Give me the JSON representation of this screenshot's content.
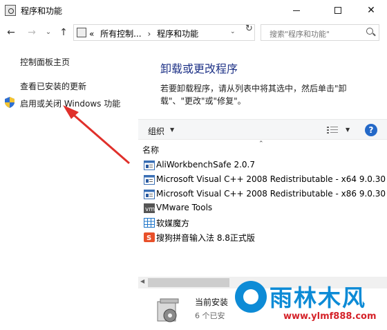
{
  "window": {
    "title": "程序和功能",
    "minimize_glyph": "",
    "close_glyph": "✕"
  },
  "addressbar": {
    "back_glyph": "←",
    "forward_glyph": "→",
    "recent_glyph": "⌄",
    "up_glyph": "↑",
    "overflow": "«",
    "crumb1": "所有控制...",
    "sep": "›",
    "crumb2": "程序和功能",
    "dropdown_glyph": "⌄",
    "refresh_glyph": "↻",
    "search_placeholder": "搜索\"程序和功能\""
  },
  "sidebar": {
    "home": "控制面板主页",
    "updates": "查看已安装的更新",
    "features": "启用或关闭 Windows 功能"
  },
  "main": {
    "heading": "卸载或更改程序",
    "description": "若要卸载程序，请从列表中将其选中，然后单击\"卸载\"、\"更改\"或\"修复\"。"
  },
  "toolbar": {
    "organize": "组织",
    "organize_caret": "▼",
    "view_caret": "▼",
    "help": "?"
  },
  "list": {
    "column_name": "名称",
    "sort_glyph": "⌃",
    "programs": [
      {
        "name": "AliWorkbenchSafe 2.0.7",
        "icon": "window-app-icon"
      },
      {
        "name": "Microsoft Visual C++ 2008 Redistributable - x64 9.0.30...",
        "icon": "window-app-icon"
      },
      {
        "name": "Microsoft Visual C++ 2008 Redistributable - x86 9.0.30...",
        "icon": "window-app-icon"
      },
      {
        "name": "VMware Tools",
        "icon": "vmware-icon"
      },
      {
        "name": "软媒魔方",
        "icon": "grid-icon"
      },
      {
        "name": "搜狗拼音输入法 8.8正式版",
        "icon": "sogou-icon"
      }
    ]
  },
  "scrollbar": {
    "left_glyph": "◀"
  },
  "details": {
    "line1": "当前安装",
    "line2": "6 个已安"
  },
  "watermark": {
    "brand": "雨林木风",
    "url": "www.ylmf888.com"
  },
  "colors": {
    "heading": "#1e3287",
    "arrow": "#e0302b",
    "watermark_blue": "#0d8bd6",
    "watermark_red": "#d5232a"
  }
}
